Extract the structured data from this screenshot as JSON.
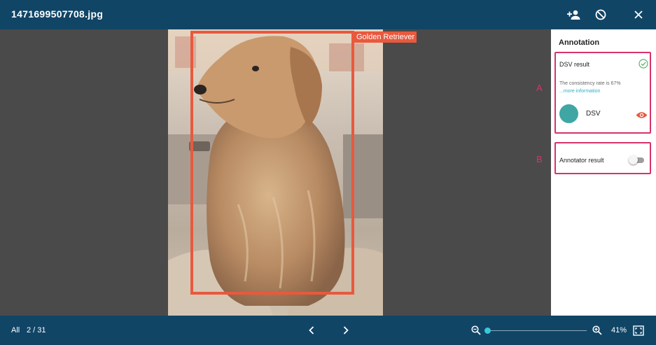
{
  "window": {
    "title": "1471699507708.jpg",
    "icons": {
      "add_person": "person-add-icon",
      "block": "block-icon",
      "close": "close-icon"
    }
  },
  "viewer": {
    "label": "Golden Retriever",
    "box_color": "#e8593e"
  },
  "side_panel": {
    "title": "Annotation",
    "dsv_card": {
      "title": "DSV result",
      "status_icon": "check-circle-icon",
      "consistency_text": "The consistency rate is 67%",
      "more_link": "...more information",
      "source_label": "DSV",
      "source_color": "#3fa6a4",
      "visibility_icon": "eye-icon"
    },
    "annotator_card": {
      "title": "Annotator result",
      "toggle_on": false
    },
    "markers": {
      "a": "A",
      "b": "B"
    },
    "highlight_color": "#d6336c"
  },
  "footer": {
    "filter": "All",
    "pager": "2 /  31",
    "zoom_level": "41%",
    "zoom_fraction": 0.0,
    "icons": {
      "prev": "chevron-left-icon",
      "next": "chevron-right-icon",
      "zoom_out": "zoom-out-icon",
      "zoom_in": "zoom-in-icon",
      "fit": "fit-screen-icon"
    }
  },
  "colors": {
    "bar": "#104566",
    "canvas": "#4a4a4a",
    "accent": "#39c8d8"
  }
}
